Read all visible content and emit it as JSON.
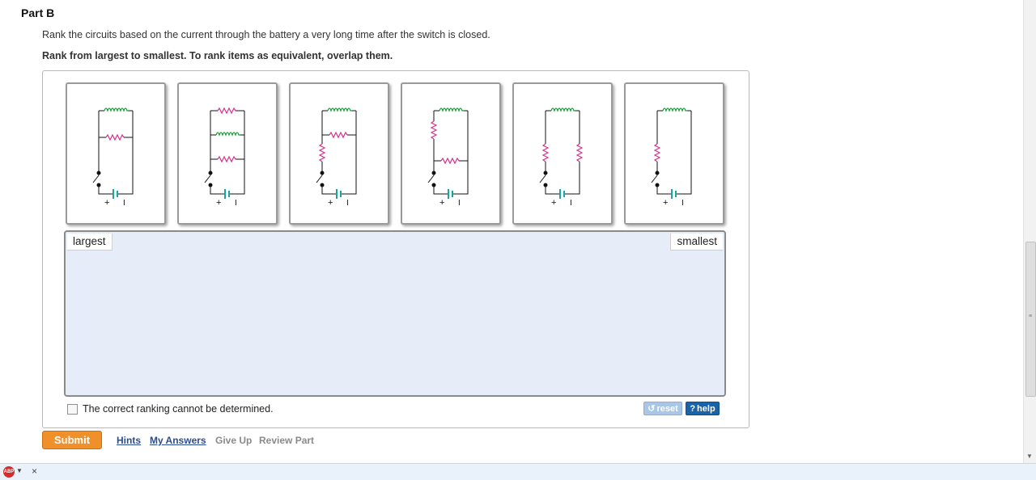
{
  "part": {
    "title": "Part B"
  },
  "question": {
    "text": "Rank the circuits based on the current through the battery a very long time after the switch is closed.",
    "instruction": "Rank from largest to smallest. To rank items as equivalent, overlap them."
  },
  "circuits": [
    {
      "id": 1,
      "components": [
        "inductor",
        "resistor",
        "switch",
        "battery"
      ],
      "battery_labels": [
        "+",
        "I"
      ]
    },
    {
      "id": 2,
      "components": [
        "resistor",
        "inductor",
        "resistor",
        "switch",
        "battery"
      ],
      "battery_labels": [
        "+",
        "I"
      ]
    },
    {
      "id": 3,
      "components": [
        "inductor",
        "resistor",
        "resistor",
        "switch",
        "battery"
      ],
      "battery_labels": [
        "+",
        "I"
      ]
    },
    {
      "id": 4,
      "components": [
        "inductor",
        "resistor",
        "resistor",
        "switch",
        "battery"
      ],
      "battery_labels": [
        "+",
        "I"
      ]
    },
    {
      "id": 5,
      "components": [
        "inductor",
        "resistor",
        "resistor",
        "switch",
        "battery"
      ],
      "battery_labels": [
        "+",
        "I"
      ]
    },
    {
      "id": 6,
      "components": [
        "inductor",
        "resistor",
        "switch",
        "battery"
      ],
      "battery_labels": [
        "+",
        "I"
      ]
    }
  ],
  "ranking": {
    "largest_label": "largest",
    "smallest_label": "smallest"
  },
  "cannot_determine": {
    "label": "The correct ranking cannot be determined.",
    "checked": false
  },
  "buttons": {
    "reset": "reset",
    "help": "help"
  },
  "actions": {
    "submit": "Submit",
    "hints": "Hints",
    "my_answers": "My Answers",
    "give_up": "Give Up",
    "review_part": "Review Part"
  },
  "statusbar": {
    "abp": "ABP"
  },
  "colors": {
    "inductor": "#1a9a3a",
    "resistor": "#d6338f",
    "battery": "#1aa3a3",
    "wire": "#111111",
    "submit": "#f0902a",
    "help": "#1b63a8",
    "dropzone": "#e6edf9"
  }
}
